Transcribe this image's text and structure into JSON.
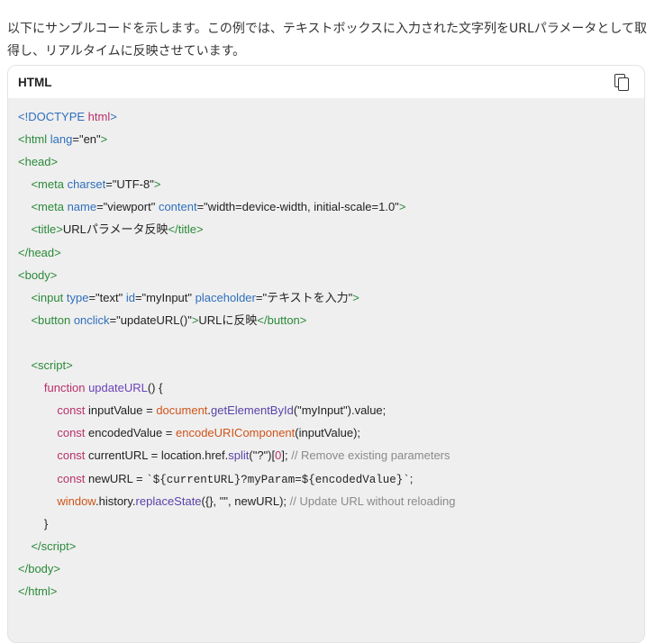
{
  "intro_text": "以下にサンプルコードを示します。この例では、テキストボックスに入力された文字列をURLパラメータとして取得し、リアルタイムに反映させています。",
  "code_block": {
    "language": "HTML",
    "copy_icon": "copy-icon",
    "lines": [
      [
        {
          "t": "<!DOCTYPE ",
          "c": "doc"
        },
        {
          "t": "html",
          "c": "kw"
        },
        {
          "t": ">",
          "c": "doc"
        }
      ],
      [
        {
          "t": "<",
          "c": "tag"
        },
        {
          "t": "html",
          "c": "tag"
        },
        {
          "t": " lang",
          "c": "attr"
        },
        {
          "t": "=\"en\"",
          "c": "str"
        },
        {
          "t": ">",
          "c": "tag"
        }
      ],
      [
        {
          "t": "<",
          "c": "tag"
        },
        {
          "t": "head",
          "c": "tag"
        },
        {
          "t": ">",
          "c": "tag"
        }
      ],
      [
        {
          "t": "    <",
          "c": "tag"
        },
        {
          "t": "meta",
          "c": "tag"
        },
        {
          "t": " charset",
          "c": "attr"
        },
        {
          "t": "=\"UTF-8\"",
          "c": "str"
        },
        {
          "t": ">",
          "c": "tag"
        }
      ],
      [
        {
          "t": "    <",
          "c": "tag"
        },
        {
          "t": "meta",
          "c": "tag"
        },
        {
          "t": " name",
          "c": "attr"
        },
        {
          "t": "=\"viewport\"",
          "c": "str"
        },
        {
          "t": " content",
          "c": "attr"
        },
        {
          "t": "=\"width=device-width, initial-scale=1.0\"",
          "c": "str"
        },
        {
          "t": ">",
          "c": "tag"
        }
      ],
      [
        {
          "t": "    <",
          "c": "tag"
        },
        {
          "t": "title",
          "c": "tag"
        },
        {
          "t": ">",
          "c": "tag"
        },
        {
          "t": "URLパラメータ反映",
          "c": "str"
        },
        {
          "t": "</",
          "c": "tag"
        },
        {
          "t": "title",
          "c": "tag"
        },
        {
          "t": ">",
          "c": "tag"
        }
      ],
      [
        {
          "t": "</",
          "c": "tag"
        },
        {
          "t": "head",
          "c": "tag"
        },
        {
          "t": ">",
          "c": "tag"
        }
      ],
      [
        {
          "t": "<",
          "c": "tag"
        },
        {
          "t": "body",
          "c": "tag"
        },
        {
          "t": ">",
          "c": "tag"
        }
      ],
      [
        {
          "t": "    <",
          "c": "tag"
        },
        {
          "t": "input",
          "c": "tag"
        },
        {
          "t": " type",
          "c": "attr"
        },
        {
          "t": "=\"text\"",
          "c": "str"
        },
        {
          "t": " id",
          "c": "attr"
        },
        {
          "t": "=\"myInput\"",
          "c": "str"
        },
        {
          "t": " placeholder",
          "c": "attr"
        },
        {
          "t": "=\"テキストを入力\"",
          "c": "str"
        },
        {
          "t": ">",
          "c": "tag"
        }
      ],
      [
        {
          "t": "    <",
          "c": "tag"
        },
        {
          "t": "button",
          "c": "tag"
        },
        {
          "t": " onclick",
          "c": "attr"
        },
        {
          "t": "=\"updateURL()\"",
          "c": "str"
        },
        {
          "t": ">",
          "c": "tag"
        },
        {
          "t": "URLに反映",
          "c": "str"
        },
        {
          "t": "</",
          "c": "tag"
        },
        {
          "t": "button",
          "c": "tag"
        },
        {
          "t": ">",
          "c": "tag"
        }
      ],
      [],
      [
        {
          "t": "    <",
          "c": "tag"
        },
        {
          "t": "script",
          "c": "tag"
        },
        {
          "t": ">",
          "c": "tag"
        }
      ],
      [
        {
          "t": "        function",
          "c": "kw"
        },
        {
          "t": " ",
          "c": "str"
        },
        {
          "t": "updateURL",
          "c": "fn"
        },
        {
          "t": "() {",
          "c": "str"
        }
      ],
      [
        {
          "t": "            const",
          "c": "kw"
        },
        {
          "t": " inputValue = ",
          "c": "str"
        },
        {
          "t": "document",
          "c": "builtin"
        },
        {
          "t": ".",
          "c": "str"
        },
        {
          "t": "getElementById",
          "c": "ident"
        },
        {
          "t": "(\"myInput\").value;",
          "c": "str"
        }
      ],
      [
        {
          "t": "            const",
          "c": "kw"
        },
        {
          "t": " encodedValue = ",
          "c": "str"
        },
        {
          "t": "encodeURIComponent",
          "c": "builtin"
        },
        {
          "t": "(inputValue);",
          "c": "str"
        }
      ],
      [
        {
          "t": "            const",
          "c": "kw"
        },
        {
          "t": " currentURL = location.href.",
          "c": "str"
        },
        {
          "t": "split",
          "c": "ident"
        },
        {
          "t": "(\"?\")[",
          "c": "str"
        },
        {
          "t": "0",
          "c": "kw"
        },
        {
          "t": "]; ",
          "c": "str"
        },
        {
          "t": "// Remove existing parameters",
          "c": "cmt"
        }
      ],
      [
        {
          "t": "            const",
          "c": "kw"
        },
        {
          "t": " newURL = ",
          "c": "str"
        },
        {
          "t": "`${currentURL}?myParam=${encodedValue}`",
          "c": "tpl"
        },
        {
          "t": ";",
          "c": "str"
        }
      ],
      [
        {
          "t": "            window",
          "c": "builtin"
        },
        {
          "t": ".history.",
          "c": "str"
        },
        {
          "t": "replaceState",
          "c": "ident"
        },
        {
          "t": "({}, \"\", newURL); ",
          "c": "str"
        },
        {
          "t": "// Update URL without reloading",
          "c": "cmt"
        }
      ],
      [
        {
          "t": "        }",
          "c": "str"
        }
      ],
      [
        {
          "t": "    </",
          "c": "tag"
        },
        {
          "t": "script",
          "c": "tag"
        },
        {
          "t": ">",
          "c": "tag"
        }
      ],
      [
        {
          "t": "</",
          "c": "tag"
        },
        {
          "t": "body",
          "c": "tag"
        },
        {
          "t": ">",
          "c": "tag"
        }
      ],
      [
        {
          "t": "</",
          "c": "tag"
        },
        {
          "t": "html",
          "c": "tag"
        },
        {
          "t": ">",
          "c": "tag"
        }
      ]
    ]
  }
}
